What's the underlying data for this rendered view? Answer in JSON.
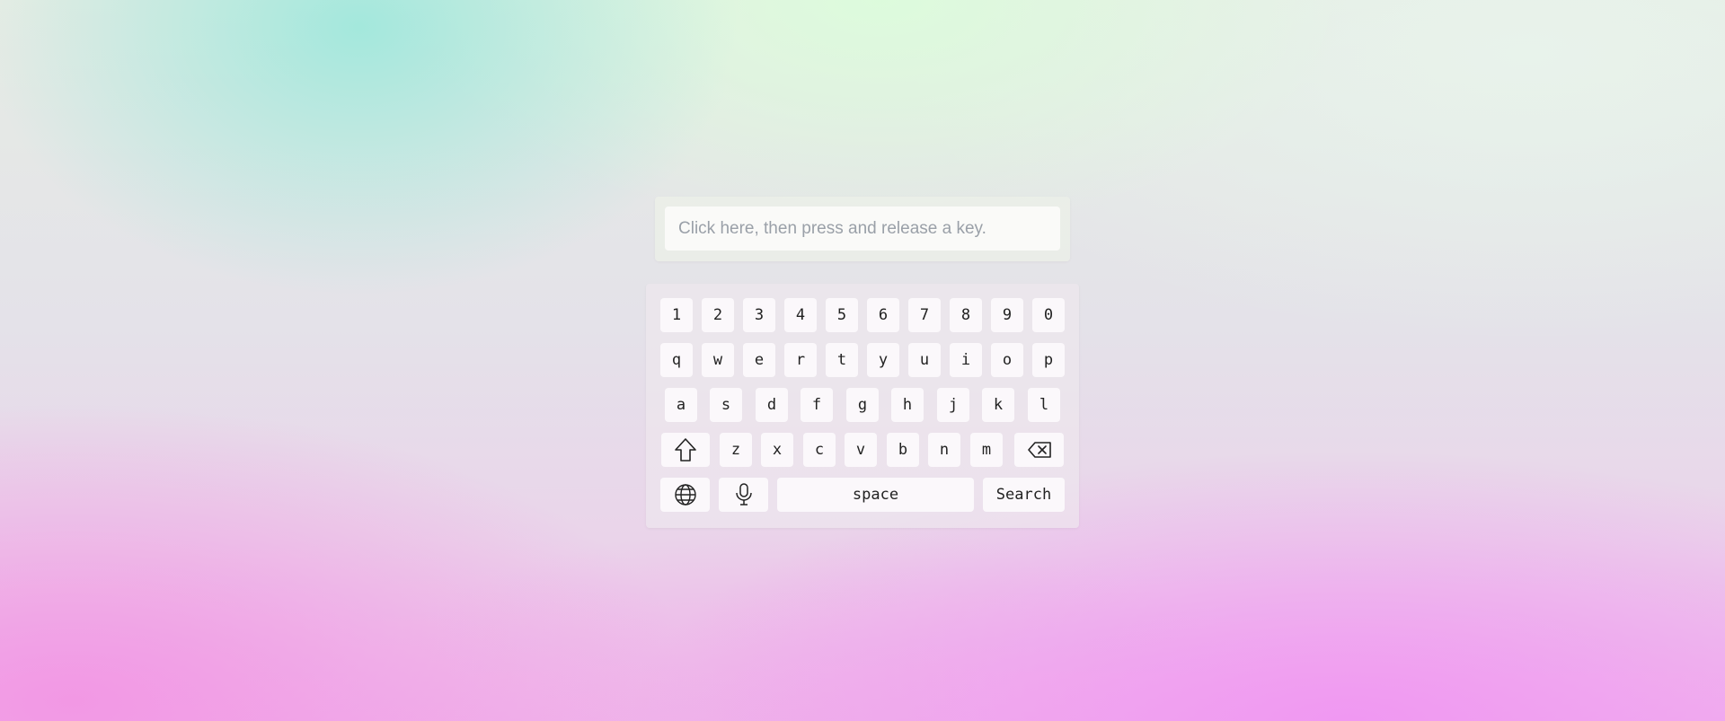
{
  "input": {
    "placeholder": "Click here, then press and release a key.",
    "value": ""
  },
  "keyboard": {
    "row_numbers": [
      "1",
      "2",
      "3",
      "4",
      "5",
      "6",
      "7",
      "8",
      "9",
      "0"
    ],
    "row_top": [
      "q",
      "w",
      "e",
      "r",
      "t",
      "y",
      "u",
      "i",
      "o",
      "p"
    ],
    "row_home": [
      "a",
      "s",
      "d",
      "f",
      "g",
      "h",
      "j",
      "k",
      "l"
    ],
    "row_bottom": [
      "z",
      "x",
      "c",
      "v",
      "b",
      "n",
      "m"
    ],
    "space_label": "space",
    "search_label": "Search",
    "icons": {
      "shift": "shift-arrow-icon",
      "backspace": "backspace-icon",
      "globe": "globe-icon",
      "microphone": "microphone-icon"
    }
  }
}
